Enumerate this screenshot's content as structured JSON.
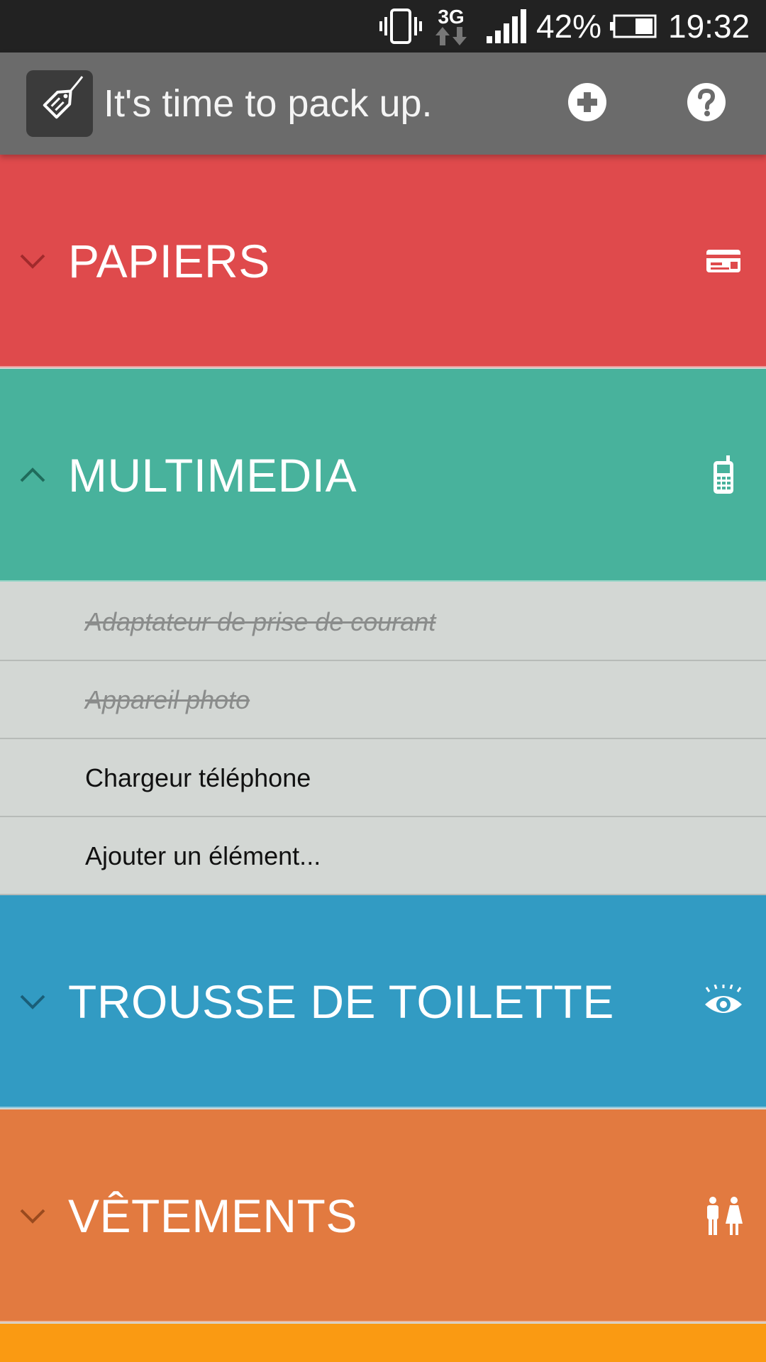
{
  "status_bar": {
    "network_type": "3G",
    "battery_percent": "42%",
    "time": "19:32",
    "icons": [
      "vibrate-icon",
      "data-3g-icon",
      "signal-icon",
      "battery-icon"
    ]
  },
  "action_bar": {
    "title": "It's time to pack up.",
    "logo_icon": "tag-icon",
    "add_icon": "plus-circle-icon",
    "help_icon": "help-circle-icon"
  },
  "categories": [
    {
      "title": "PAPIERS",
      "color": "#df4a4c",
      "expanded": false,
      "icon": "id-card-icon",
      "chevron_color": "#a12a2c"
    },
    {
      "title": "MULTIMEDIA",
      "color": "#48b29c",
      "expanded": true,
      "icon": "mobile-phone-icon",
      "chevron_color": "#1f6b5b"
    },
    {
      "title": "TROUSSE DE TOILETTE",
      "color": "#329bc3",
      "expanded": false,
      "icon": "eye-icon",
      "chevron_color": "#1a5e78"
    },
    {
      "title": "VÊTEMENTS",
      "color": "#e27a40",
      "expanded": false,
      "icon": "people-icon",
      "chevron_color": "#9a4a1e"
    }
  ],
  "multimedia_items": [
    {
      "label": "Adaptateur de prise de courant",
      "checked": true
    },
    {
      "label": "Appareil photo",
      "checked": true
    },
    {
      "label": "Chargeur téléphone",
      "checked": false
    },
    {
      "label": "Ajouter un élément...",
      "checked": false
    }
  ],
  "next_category_color": "#fa9a12"
}
